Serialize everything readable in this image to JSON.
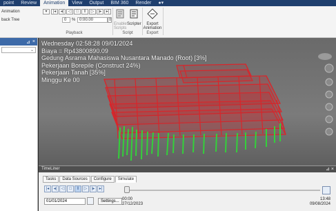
{
  "ribbon": {
    "tabs": [
      "point",
      "Review",
      "Animation",
      "View",
      "Output",
      "BIM 360",
      "Render",
      "●▾"
    ],
    "active_tab_index": 2,
    "animation_label": "Animation",
    "playback_tree_label": "back Tree",
    "frame_value": "0",
    "percent_label": "%",
    "time_value": "0:00.00",
    "playback_group": "Playback",
    "enable_scripts_label": "Enable Scripts",
    "scripter_label": "Scripter",
    "script_group": "Script",
    "export_animation_label": "Export Animation",
    "export_group": "Export"
  },
  "viewport": {
    "hud_lines": [
      "Wednesday 02:58:28 09/01/2024",
      "Biaya = Rp43800890.09",
      "Gedung Asrama Mahasiswa Nusantara Manado (Root) [3%]",
      "Pekerjaan Borepile (Construct 24%)",
      "Pekerjaan Tanah [35%]",
      "Minggu Ke 00"
    ]
  },
  "timeliner": {
    "title": "TimeLiner",
    "tabs": [
      "Tasks",
      "Data Sources",
      "Configure",
      "Simulate"
    ],
    "active_tab_index": 3,
    "date_value": "01/01/2024",
    "settings_label": "Settings...",
    "start_time": "00:00",
    "start_date": "27/12/2023",
    "end_time": "13:48",
    "end_date": "09/08/2024"
  },
  "colors": {
    "structure": "#d8262b",
    "piles": "#33d13a",
    "ribbon_tab_bar": "#1f3f6e"
  }
}
